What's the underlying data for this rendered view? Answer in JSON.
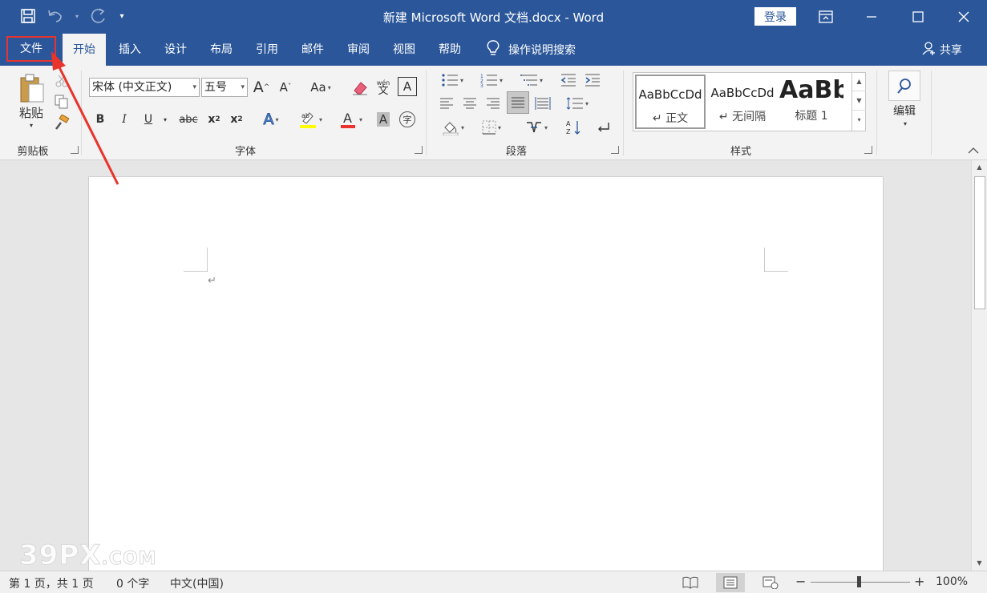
{
  "titlebar": {
    "doc_title": "新建 Microsoft Word 文档.docx  -  Word",
    "login": "登录",
    "qat_icons": [
      "save-icon",
      "undo-icon",
      "redo-icon",
      "customize-icon"
    ],
    "window_controls": [
      "ribbon-display-icon",
      "minimize-icon",
      "maximize-icon",
      "close-icon"
    ]
  },
  "tabs": [
    "文件",
    "开始",
    "插入",
    "设计",
    "布局",
    "引用",
    "邮件",
    "审阅",
    "视图",
    "帮助"
  ],
  "active_tab": "开始",
  "search": {
    "label": "操作说明搜索"
  },
  "share": {
    "label": "共享"
  },
  "ribbon": {
    "clipboard": {
      "label": "剪贴板",
      "paste": "粘贴"
    },
    "font": {
      "label": "字体",
      "font_name": "宋体 (中文正文)",
      "font_size": "五号",
      "case_btn": "Aa",
      "bold": "B",
      "italic": "I",
      "underline": "U",
      "strike": "abc",
      "sub": "x",
      "sup": "x",
      "sub_mark": "2",
      "sup_mark": "2",
      "grow": "A",
      "shrink": "A",
      "phonetic": "wén",
      "phonetic_char": "文",
      "border_char": "A",
      "color_char": "A",
      "shade_char": "A",
      "enclose_char": "字"
    },
    "paragraph": {
      "label": "段落"
    },
    "styles": {
      "label": "样式",
      "items": [
        {
          "preview": "AaBbCcDd",
          "name": "↵ 正文"
        },
        {
          "preview": "AaBbCcDd",
          "name": "↵ 无间隔"
        },
        {
          "preview": "AaBb",
          "name": "标题 1"
        }
      ]
    },
    "editing": {
      "label": "编辑"
    }
  },
  "document": {
    "para_mark": "↵"
  },
  "status": {
    "page": "第 1 页，共 1 页",
    "words": "0 个字",
    "language": "中文(中国)",
    "zoom": "100%",
    "zoom_level": 100
  },
  "watermark": {
    "text": "39PX",
    "suffix": ".COM"
  },
  "colors": {
    "accent": "#2b579a",
    "highlight_marker": "#e8342c"
  }
}
